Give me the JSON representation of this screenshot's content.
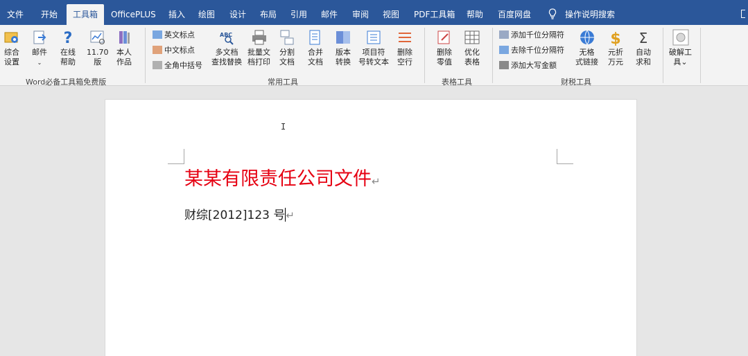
{
  "tabs": [
    "文件",
    "开始",
    "工具箱",
    "OfficePLUS",
    "插入",
    "绘图",
    "设计",
    "布局",
    "引用",
    "邮件",
    "审阅",
    "视图",
    "PDF工具箱",
    "帮助",
    "百度网盘"
  ],
  "search_label": "操作说明搜索",
  "ribbon": {
    "group1": {
      "label": "Word必备工具箱免费版",
      "buttons": [
        {
          "l1": "综合",
          "l2": "设置"
        },
        {
          "l1": "邮件",
          "l2": "⌄"
        },
        {
          "l1": "在线",
          "l2": "帮助"
        },
        {
          "l1": "11.70",
          "l2": "版"
        },
        {
          "l1": "本人",
          "l2": "作品"
        }
      ]
    },
    "group2": {
      "label": "常用工具",
      "small_buttons": [
        "英文标点",
        "中文标点",
        "全角中括号"
      ],
      "buttons": [
        {
          "l1": "多文档",
          "l2": "查找替换"
        },
        {
          "l1": "批量文",
          "l2": "档打印"
        },
        {
          "l1": "分割",
          "l2": "文档"
        },
        {
          "l1": "合并",
          "l2": "文档"
        },
        {
          "l1": "版本",
          "l2": "转换"
        },
        {
          "l1": "项目符",
          "l2": "号转文本"
        },
        {
          "l1": "删除",
          "l2": "空行"
        }
      ]
    },
    "group3": {
      "label": "表格工具",
      "buttons": [
        {
          "l1": "删除",
          "l2": "零值"
        },
        {
          "l1": "优化",
          "l2": "表格"
        }
      ]
    },
    "group4": {
      "label": "财税工具",
      "small_buttons": [
        "添加千位分隔符",
        "去除千位分隔符",
        "添加大写金额"
      ],
      "buttons": [
        {
          "l1": "无格",
          "l2": "式链接"
        },
        {
          "l1": "元折",
          "l2": "万元"
        },
        {
          "l1": "自动",
          "l2": "求和"
        }
      ]
    },
    "group5": {
      "buttons": [
        {
          "l1": "破解工",
          "l2": "具⌄"
        }
      ]
    }
  },
  "document": {
    "title": "某某有限责任公司文件",
    "line2": "财综[2012]123 号"
  },
  "colors": {
    "tabbar": "#2b579a",
    "ribbon": "#f3f3f3",
    "doc_title": "#e60012"
  }
}
